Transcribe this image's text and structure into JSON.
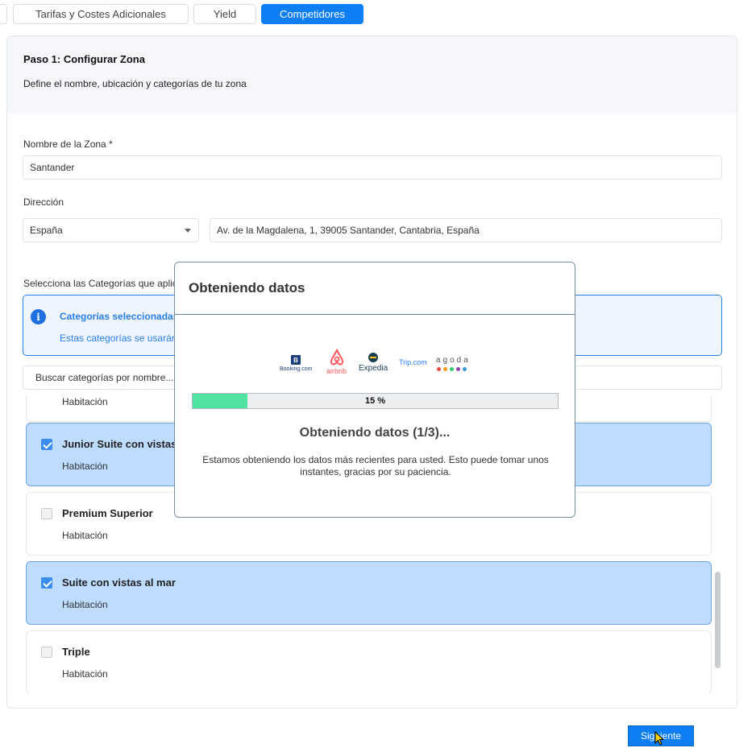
{
  "tabs": [
    {
      "label": "Tarifas y  Costes Adicionales"
    },
    {
      "label": "Yield"
    },
    {
      "label": "Competidores"
    }
  ],
  "step": {
    "title": "Paso 1: Configurar Zona",
    "subtitle": "Define el nombre, ubicación y categorías de tu zona"
  },
  "form": {
    "zone_label": "Nombre de la Zona *",
    "zone_value": "Santander",
    "address_label": "Dirección",
    "country_value": "España",
    "address_value": "Av. de la Magdalena, 1, 39005 Santander, Cantabria, España",
    "categories_label": "Selecciona las Categorías que aplic",
    "search_placeholder": "Buscar categorías por nombre..."
  },
  "info": {
    "icon": "info-icon",
    "title": "Categorías seleccionadas: :",
    "text": "Estas categorías se usarán"
  },
  "categories": [
    {
      "name": "",
      "type": "Habitación",
      "checked": false
    },
    {
      "name": "Junior Suite con vistas",
      "type": "Habitación",
      "checked": true
    },
    {
      "name": "Premium Superior",
      "type": "Habitación",
      "checked": false
    },
    {
      "name": "Suite con vistas al mar",
      "type": "Habitación",
      "checked": true
    },
    {
      "name": "Triple",
      "type": "Habitación",
      "checked": false
    }
  ],
  "next_button": "Siguiente",
  "modal": {
    "title": "Obteniendo datos",
    "progress_text": "15 %",
    "progress_fraction": 0.15,
    "status": "Obteniendo datos (1/3)...",
    "message": "Estamos obteniendo los datos más recientes para usted. Esto puede tomar unos instantes, gracias por su paciencia.",
    "logos": {
      "booking_badge": "B",
      "booking": "Booking.com",
      "airbnb": "airbnb",
      "expedia": "Expedia",
      "trip": "Trip.com",
      "agoda": "agoda"
    }
  },
  "colors": {
    "primary": "#0d7ef4",
    "selected_bg": "#bddcff",
    "info_blue": "#2a7ee6",
    "progress_green": "#52e3a0",
    "airbnb": "#ff5a5f"
  }
}
